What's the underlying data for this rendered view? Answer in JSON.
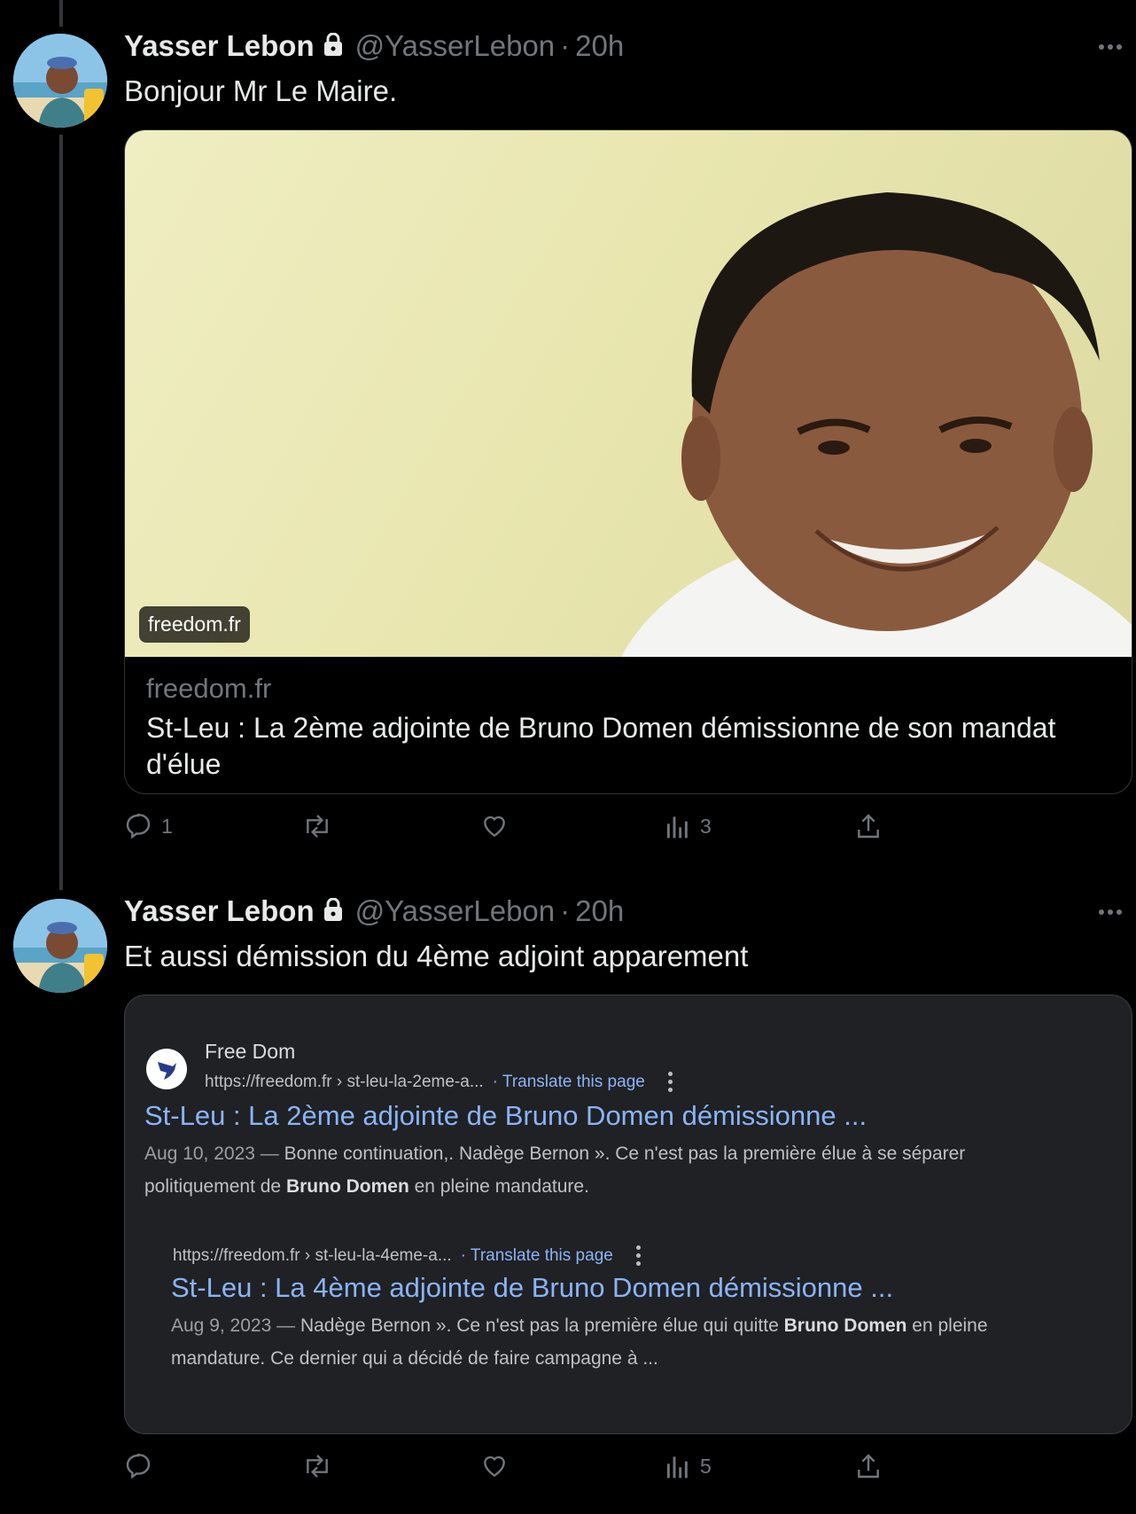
{
  "tweets": [
    {
      "name": "Yasser Lebon",
      "handle": "@YasserLebon",
      "separator": "·",
      "time": "20h",
      "text": "Bonjour Mr Le Maire.",
      "card": {
        "image_badge": "freedom.fr",
        "domain": "freedom.fr",
        "title": "St-Leu : La 2ème adjointe de Bruno Domen démissionne de son mandat d'élue"
      },
      "actions": {
        "replies": "1",
        "reposts": "",
        "likes": "",
        "views": "3"
      }
    },
    {
      "name": "Yasser Lebon",
      "handle": "@YasserLebon",
      "separator": "·",
      "time": "20h",
      "text": "Et aussi démission du 4ème adjoint apparement",
      "screenshot": {
        "site_name": "Free Dom",
        "results": [
          {
            "url": "https://freedom.fr › st-leu-la-2eme-a...",
            "translate": "· Translate this page",
            "title": "St-Leu : La 2ème adjointe de Bruno Domen démissionne ...",
            "date": "Aug 10, 2023 — ",
            "snippet_a": "Bonne continuation,. Nadège Bernon ». Ce n'est pas la première élue à se séparer politiquement de ",
            "snippet_bold": "Bruno Domen",
            "snippet_b": " en pleine mandature."
          },
          {
            "url": "https://freedom.fr › st-leu-la-4eme-a...",
            "translate": "· Translate this page",
            "title": "St-Leu : La 4ème adjointe de Bruno Domen démissionne ...",
            "date": "Aug 9, 2023 — ",
            "snippet_a": "Nadège Bernon ». Ce n'est pas la première élue qui quitte ",
            "snippet_bold": "Bruno Domen",
            "snippet_b": " en pleine mandature. Ce dernier qui a décidé de faire campagne à ..."
          }
        ]
      },
      "actions": {
        "replies": "",
        "reposts": "",
        "likes": "",
        "views": "5"
      }
    }
  ],
  "colors": {
    "background": "#000000",
    "text": "#e7e9ea",
    "muted": "#71767b",
    "link_blue": "#8ab4f8",
    "google_bg": "#202124"
  },
  "icons": [
    "lock-icon",
    "more-icon",
    "reply-icon",
    "repost-icon",
    "like-icon",
    "views-icon",
    "share-icon",
    "freedom-bird-icon",
    "kebab-icon"
  ]
}
